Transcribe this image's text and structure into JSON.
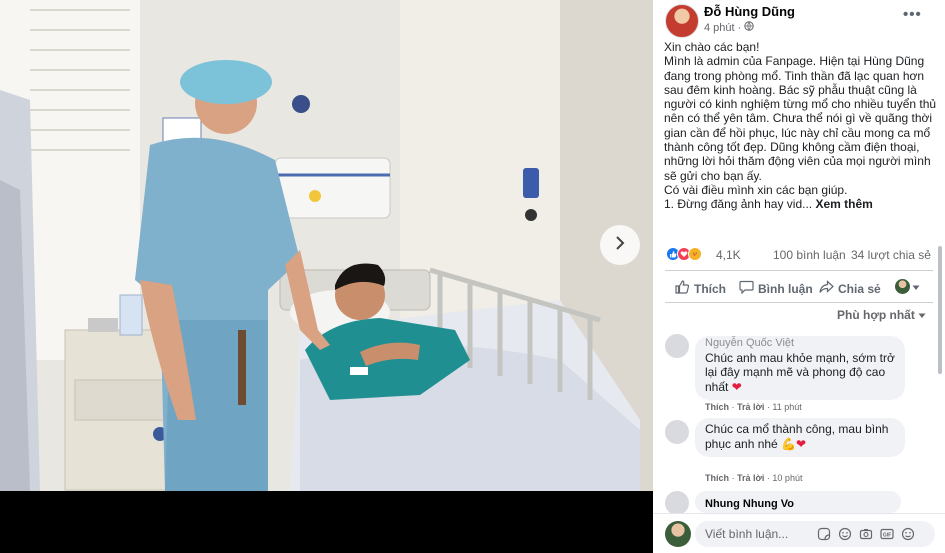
{
  "viewer": {
    "next_icon": "chevron-right-icon"
  },
  "post": {
    "author": "Đỗ Hùng Dũng",
    "time": "4 phút",
    "audience_icon": "globe-icon",
    "more_icon": "more-dots-icon",
    "paragraphs": [
      "Xin chào các bạn!",
      "Mình là admin của Fanpage. Hiện tại Hùng Dũng đang trong phòng mổ. Tinh thần đã lạc quan hơn sau đêm kinh hoàng. Bác sỹ phẫu thuật cũng là người có kinh nghiệm từng mổ cho nhiều tuyển thủ nên có thể yên tâm. Chưa thể nói gì về quãng thời gian cần để hồi phục, lúc này chỉ cầu mong ca mổ thành công tốt đẹp. Dũng không cầm điện thoại, những lời hỏi thăm động viên của mọi người mình sẽ gửi cho bạn ấy.",
      "Có vài điều mình xin các bạn giúp."
    ],
    "truncated_line": "1. Đừng đăng ảnh hay vid...",
    "see_more": "Xem thêm",
    "reaction_count": "4,1K",
    "comment_count": "100 bình luận",
    "share_count": "34 lượt chia sẻ"
  },
  "actions": {
    "like": "Thích",
    "comment": "Bình luận",
    "share": "Chia sẻ"
  },
  "sort_label": "Phù hợp nhất",
  "comments": [
    {
      "name": "Nguyễn Quốc Việt",
      "text": "Chúc anh mau khỏe mạnh, sớm trở lại đây mạnh mẽ và phong độ cao nhất",
      "like": "Thích",
      "reply": "Trả lời",
      "time": "11 phút"
    },
    {
      "name": "",
      "text": "Chúc ca mổ thành công, mau bình phục anh nhé",
      "like": "Thích",
      "reply": "Trả lời",
      "time": "10 phút"
    },
    {
      "name": "Nhung Nhung Vo",
      "text": ""
    }
  ],
  "composer": {
    "placeholder": "Viết bình luận..."
  },
  "colors": {
    "panel_bg": "#ffffff",
    "bubble": "#f0f2f5",
    "like_blue": "#1877f2",
    "heart_red": "#f33e58"
  }
}
